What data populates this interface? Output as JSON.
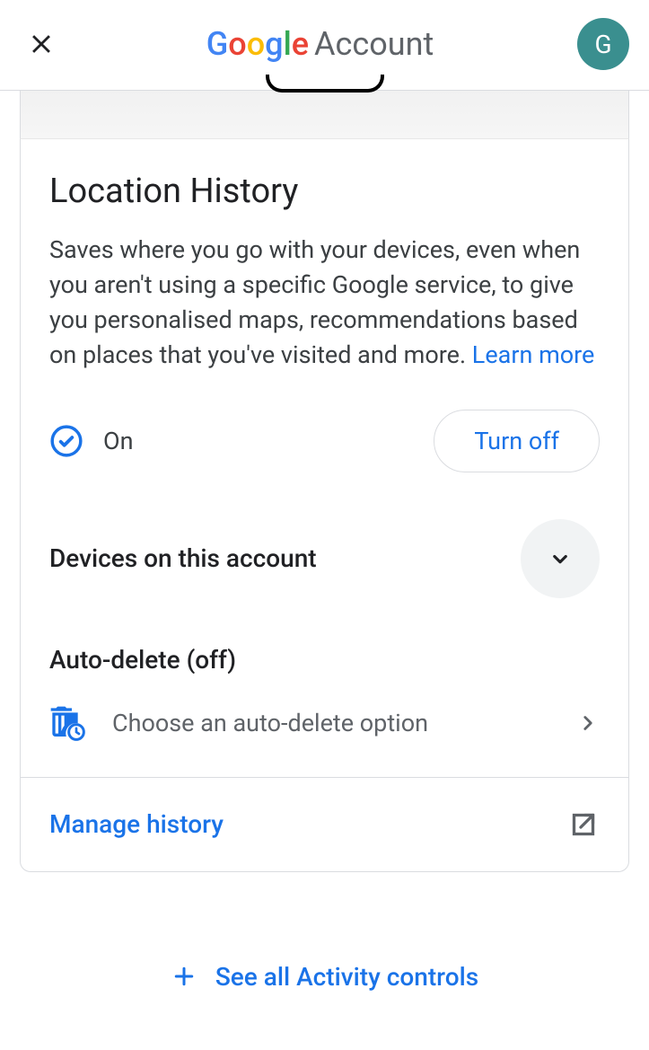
{
  "header": {
    "brand_word": "Google",
    "account_word": "Account",
    "avatar_letter": "G"
  },
  "card": {
    "title": "Location History",
    "description": "Saves where you go with your devices, even when you aren't using a specific Google service, to give you personalised maps, recommendations based on places that you've visited and more. ",
    "learn_more": "Learn more",
    "status_label": "On",
    "turn_off_label": "Turn off",
    "devices_label": "Devices on this account",
    "autodelete_title": "Auto-delete (off)",
    "autodelete_option": "Choose an auto-delete option",
    "manage_history": "Manage history"
  },
  "footer": {
    "see_all": "See all Activity controls"
  }
}
